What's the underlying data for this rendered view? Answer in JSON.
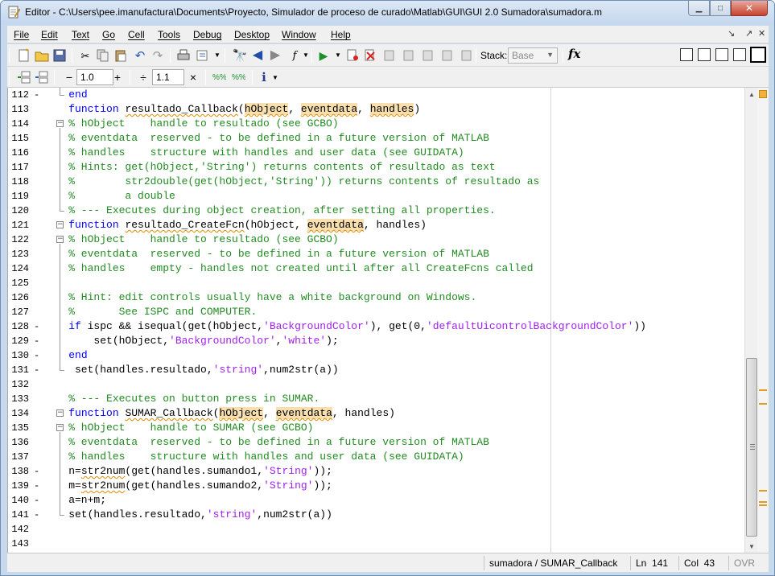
{
  "window": {
    "title": "Editor - C:\\Users\\pee.imanufactura\\Documents\\Proyecto, Simulador de proceso de curado\\Matlab\\GUI\\GUI 2.0 Sumadora\\sumadora.m",
    "minimize_icon": "minimize-icon",
    "maximize_icon": "maximize-icon",
    "close_icon": "close-icon"
  },
  "menu": {
    "items": [
      "File",
      "Edit",
      "Text",
      "Go",
      "Cell",
      "Tools",
      "Debug",
      "Desktop",
      "Window",
      "Help"
    ]
  },
  "toolbar": {
    "stack_label": "Stack:",
    "stack_value": "Base",
    "fx_label": "fx"
  },
  "cell_toolbar": {
    "minus_label": "−",
    "increment_value": "1.0",
    "plus_label": "+",
    "divide_label": "÷",
    "factor_value": "1.1",
    "times_label": "×"
  },
  "editor": {
    "lines": [
      {
        "num": "112",
        "dash": "-",
        "code": "    end"
      },
      {
        "num": "113",
        "dash": "",
        "code": "    function resultado_Callback(hObject, eventdata, handles)"
      },
      {
        "num": "114",
        "dash": "",
        "code": "    % hObject    handle to resultado (see GCBO)"
      },
      {
        "num": "115",
        "dash": "",
        "code": "    % eventdata  reserved - to be defined in a future version of MATLAB"
      },
      {
        "num": "116",
        "dash": "",
        "code": "    % handles    structure with handles and user data (see GUIDATA)"
      },
      {
        "num": "117",
        "dash": "",
        "code": "    % Hints: get(hObject,'String') returns contents of resultado as text"
      },
      {
        "num": "118",
        "dash": "",
        "code": "    %        str2double(get(hObject,'String')) returns contents of resultado as"
      },
      {
        "num": "119",
        "dash": "",
        "code": "    %        a double"
      },
      {
        "num": "120",
        "dash": "",
        "code": "    % --- Executes during object creation, after setting all properties."
      },
      {
        "num": "121",
        "dash": "",
        "code": "    function resultado_CreateFcn(hObject, eventdata, handles)"
      },
      {
        "num": "122",
        "dash": "",
        "code": "    % hObject    handle to resultado (see GCBO)"
      },
      {
        "num": "123",
        "dash": "",
        "code": "    % eventdata  reserved - to be defined in a future version of MATLAB"
      },
      {
        "num": "124",
        "dash": "",
        "code": "    % handles    empty - handles not created until after all CreateFcns called"
      },
      {
        "num": "125",
        "dash": "",
        "code": ""
      },
      {
        "num": "126",
        "dash": "",
        "code": "    % Hint: edit controls usually have a white background on Windows."
      },
      {
        "num": "127",
        "dash": "",
        "code": "    %       See ISPC and COMPUTER."
      },
      {
        "num": "128",
        "dash": "-",
        "code": "    if ispc && isequal(get(hObject,'BackgroundColor'), get(0,'defaultUicontrolBackgroundColor'))"
      },
      {
        "num": "129",
        "dash": "-",
        "code": "        set(hObject,'BackgroundColor','white');"
      },
      {
        "num": "130",
        "dash": "-",
        "code": "    end"
      },
      {
        "num": "131",
        "dash": "-",
        "code": "     set(handles.resultado,'string',num2str(a))"
      },
      {
        "num": "132",
        "dash": "",
        "code": ""
      },
      {
        "num": "133",
        "dash": "",
        "code": "    % --- Executes on button press in SUMAR."
      },
      {
        "num": "134",
        "dash": "",
        "code": "    function SUMAR_Callback(hObject, eventdata, handles)"
      },
      {
        "num": "135",
        "dash": "",
        "code": "    % hObject    handle to SUMAR (see GCBO)"
      },
      {
        "num": "136",
        "dash": "",
        "code": "    % eventdata  reserved - to be defined in a future version of MATLAB"
      },
      {
        "num": "137",
        "dash": "",
        "code": "    % handles    structure with handles and user data (see GUIDATA)"
      },
      {
        "num": "138",
        "dash": "-",
        "code": "    n=str2num(get(handles.sumando1,'String'));"
      },
      {
        "num": "139",
        "dash": "-",
        "code": "    m=str2num(get(handles.sumando2,'String'));"
      },
      {
        "num": "140",
        "dash": "-",
        "code": "    a=n+m;"
      },
      {
        "num": "141",
        "dash": "-",
        "code": "    set(handles.resultado,'string',num2str(a))"
      },
      {
        "num": "142",
        "dash": "",
        "code": ""
      },
      {
        "num": "143",
        "dash": "",
        "code": ""
      }
    ]
  },
  "status": {
    "function": "sumadora / SUMAR_Callback",
    "ln_label": "Ln",
    "ln_value": "141",
    "col_label": "Col",
    "col_value": "43",
    "ovr": "OVR"
  }
}
